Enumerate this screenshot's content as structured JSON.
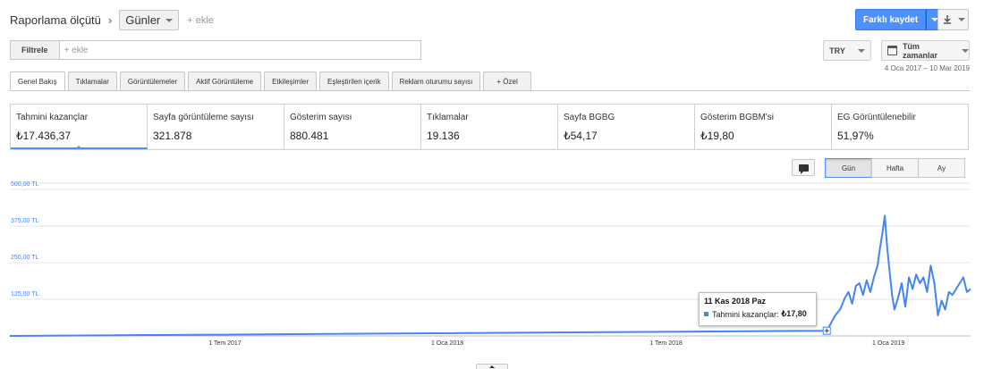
{
  "header": {
    "title": "Raporlama ölçütü",
    "separator": "›",
    "dimension_label": "Günler",
    "add_label": "+ ekle",
    "save_label": "Farklı kaydet",
    "download_icon": "download-icon",
    "accent_color": "#4d90fe"
  },
  "filter": {
    "label": "Filtrele",
    "placeholder": "+ ekle"
  },
  "currency": {
    "label": "TRY"
  },
  "date": {
    "label": "Tüm zamanlar",
    "range": "4 Oca 2017 – 10 Mar 2019"
  },
  "tabs": [
    {
      "label": "Genel Bakış",
      "active": true
    },
    {
      "label": "Tıklamalar"
    },
    {
      "label": "Görüntülemeler"
    },
    {
      "label": "Aktif Görüntüleme"
    },
    {
      "label": "Etkileşimler"
    },
    {
      "label": "Eşleştirilen içerik"
    },
    {
      "label": "Reklam oturumu sayısı"
    },
    {
      "label": "+ Özel"
    }
  ],
  "metrics": [
    {
      "name": "Tahmini kazançlar",
      "value": "₺17.436,37",
      "selected": true
    },
    {
      "name": "Sayfa görüntüleme sayısı",
      "value": "321.878"
    },
    {
      "name": "Gösterim sayısı",
      "value": "880.481"
    },
    {
      "name": "Tıklamalar",
      "value": "19.136"
    },
    {
      "name": "Sayfa BGBG",
      "value": "₺54,17"
    },
    {
      "name": "Gösterim BGBM'si",
      "value": "₺19,80"
    },
    {
      "name": "EG Görüntülenebilir",
      "value": "51,97%"
    }
  ],
  "granularity": {
    "day": "Gün",
    "week": "Hafta",
    "month": "Ay",
    "selected": "Gün"
  },
  "tooltip": {
    "date": "11 Kas 2018 Paz",
    "series": "Tahmini kazançlar:",
    "value": "₺17,80"
  },
  "chart_data": {
    "type": "line",
    "series_color": "#4285f4",
    "y_ticks": [
      "500,00 TL",
      "375,00 TL",
      "250,00 TL",
      "125,00 TL"
    ],
    "y_tick_values": [
      500,
      375,
      250,
      125
    ],
    "ylim": [
      0,
      500
    ],
    "x_ticks": [
      "1 Tem 2017",
      "1 Oca 2018",
      "1 Tem 2018",
      "1 Oca 2019"
    ],
    "x_tick_dates": [
      "2017-07-01",
      "2018-01-01",
      "2018-07-01",
      "2019-01-01"
    ],
    "x_range": [
      "2017-01-04",
      "2019-03-10"
    ],
    "grid": true,
    "series": [
      {
        "points": [
          [
            "2017-01-04",
            0
          ],
          [
            "2018-11-11",
            17.8
          ],
          [
            "2018-11-14",
            40
          ],
          [
            "2018-11-18",
            70
          ],
          [
            "2018-11-22",
            90
          ],
          [
            "2018-11-26",
            130
          ],
          [
            "2018-11-29",
            150
          ],
          [
            "2018-12-02",
            110
          ],
          [
            "2018-12-05",
            170
          ],
          [
            "2018-12-08",
            180
          ],
          [
            "2018-12-11",
            140
          ],
          [
            "2018-12-14",
            190
          ],
          [
            "2018-12-17",
            150
          ],
          [
            "2018-12-20",
            200
          ],
          [
            "2018-12-23",
            240
          ],
          [
            "2018-12-25",
            300
          ],
          [
            "2018-12-27",
            350
          ],
          [
            "2018-12-29",
            410
          ],
          [
            "2018-12-31",
            300
          ],
          [
            "2019-01-02",
            220
          ],
          [
            "2019-01-04",
            140
          ],
          [
            "2019-01-06",
            90
          ],
          [
            "2019-01-09",
            130
          ],
          [
            "2019-01-12",
            180
          ],
          [
            "2019-01-15",
            100
          ],
          [
            "2019-01-18",
            200
          ],
          [
            "2019-01-21",
            160
          ],
          [
            "2019-01-24",
            210
          ],
          [
            "2019-01-27",
            180
          ],
          [
            "2019-01-30",
            200
          ],
          [
            "2019-02-02",
            150
          ],
          [
            "2019-02-05",
            240
          ],
          [
            "2019-02-08",
            180
          ],
          [
            "2019-02-11",
            70
          ],
          [
            "2019-02-14",
            120
          ],
          [
            "2019-02-17",
            90
          ],
          [
            "2019-02-20",
            150
          ],
          [
            "2019-02-23",
            140
          ],
          [
            "2019-02-26",
            160
          ],
          [
            "2019-03-01",
            180
          ],
          [
            "2019-03-04",
            200
          ],
          [
            "2019-03-07",
            150
          ],
          [
            "2019-03-10",
            160
          ]
        ]
      }
    ]
  }
}
